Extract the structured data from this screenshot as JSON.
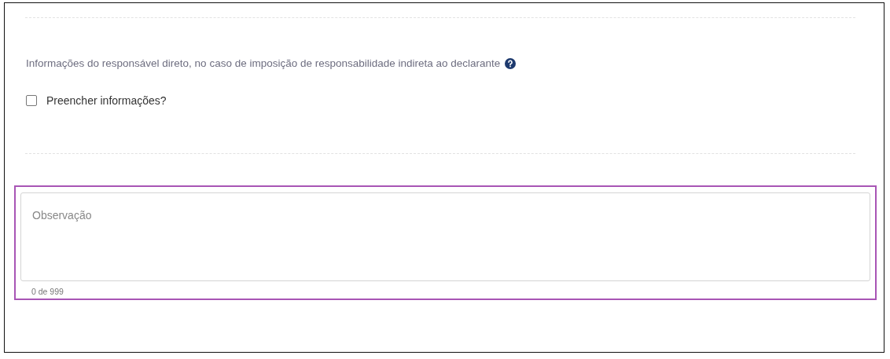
{
  "section": {
    "label": "Informações do responsável direto, no caso de imposição de responsabilidade indireta ao declarante"
  },
  "fill_checkbox": {
    "label": "Preencher informações?",
    "checked": false
  },
  "observation": {
    "placeholder": "Observação",
    "counter": "0 de 999",
    "highlighted": true
  }
}
